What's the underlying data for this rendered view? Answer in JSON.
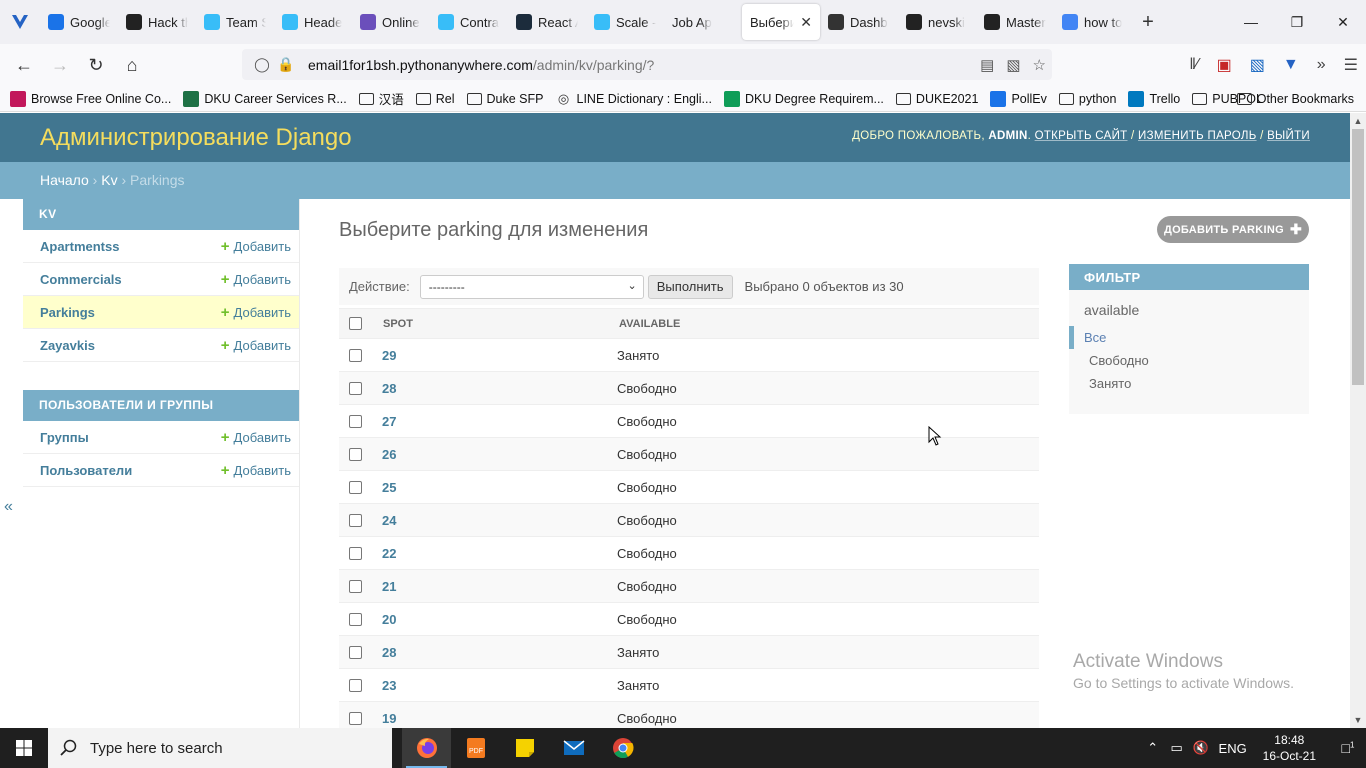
{
  "browser": {
    "tabs": [
      {
        "label": "Google",
        "icon": "calendar-icon",
        "color": "#1a73e8"
      },
      {
        "label": "Hack the",
        "icon": "d-logo-icon",
        "color": "#222222"
      },
      {
        "label": "Team S",
        "icon": "tailwind-icon",
        "color": "#38bdf8"
      },
      {
        "label": "Heade",
        "icon": "tailwind-icon",
        "color": "#38bdf8"
      },
      {
        "label": "Online",
        "icon": "s-logo-icon",
        "color": "#6b4fbb"
      },
      {
        "label": "Contra",
        "icon": "tailwind-icon",
        "color": "#38bdf8"
      },
      {
        "label": "React A",
        "icon": "react-icon",
        "color": "#1c2c3c"
      },
      {
        "label": "Scale -",
        "icon": "tailwind-icon",
        "color": "#38bdf8"
      },
      {
        "label": "Job Ap",
        "icon": "",
        "color": "#ffffff"
      },
      {
        "label": "Выбери",
        "icon": "",
        "color": "#ffffff",
        "active": true
      },
      {
        "label": "Dashb",
        "icon": "gauge-icon",
        "color": "#333333"
      },
      {
        "label": "nevski",
        "icon": "github-icon",
        "color": "#222222"
      },
      {
        "label": "Master",
        "icon": "github-icon",
        "color": "#222222"
      },
      {
        "label": "how to",
        "icon": "google-icon",
        "color": "#4285f4"
      }
    ],
    "url_host": "email1for1bsh.pythonanywhere.com",
    "url_path": "/admin/kv/parking/?",
    "bookmarks": [
      {
        "label": "Browse Free Online Co...",
        "icon": "site-icon",
        "color": "#c2185b"
      },
      {
        "label": "DKU Career Services R...",
        "icon": "excel-icon",
        "color": "#1e7145"
      },
      {
        "label": "汉语",
        "icon": "folder-icon"
      },
      {
        "label": "Rel",
        "icon": "folder-icon"
      },
      {
        "label": "Duke SFP",
        "icon": "folder-icon"
      },
      {
        "label": "LINE Dictionary : Engli...",
        "icon": "globe-icon"
      },
      {
        "label": "DKU Degree Requirem...",
        "icon": "sheets-icon",
        "color": "#0f9d58"
      },
      {
        "label": "DUKE2021",
        "icon": "folder-icon"
      },
      {
        "label": "PollEv",
        "icon": "pollev-icon",
        "color": "#1a73e8"
      },
      {
        "label": "python",
        "icon": "folder-icon"
      },
      {
        "label": "Trello",
        "icon": "trello-icon",
        "color": "#0079bf"
      },
      {
        "label": "PUBPOL",
        "icon": "folder-icon"
      }
    ],
    "other_bookmarks": "Other Bookmarks"
  },
  "admin": {
    "site_title": "Администрирование Django",
    "user_tools": {
      "welcome": "ДОБРО ПОЖАЛОВАТЬ,",
      "username": "ADMIN",
      "view_site": "ОТКРЫТЬ САЙТ",
      "change_password": "ИЗМЕНИТЬ ПАРОЛЬ",
      "logout": "ВЫЙТИ"
    },
    "breadcrumbs": {
      "home": "Начало",
      "app": "Kv",
      "current": "Parkings"
    },
    "sidebar": {
      "apps": [
        {
          "caption": "KV",
          "models": [
            {
              "name": "Apartmentss",
              "add": "Добавить"
            },
            {
              "name": "Commercials",
              "add": "Добавить"
            },
            {
              "name": "Parkings",
              "add": "Добавить",
              "current": true
            },
            {
              "name": "Zayavkis",
              "add": "Добавить"
            }
          ]
        },
        {
          "caption": "ПОЛЬЗОВАТЕЛИ И ГРУППЫ",
          "models": [
            {
              "name": "Группы",
              "add": "Добавить"
            },
            {
              "name": "Пользователи",
              "add": "Добавить"
            }
          ]
        }
      ],
      "collapse_glyph": "«"
    },
    "content": {
      "title": "Выберите parking для изменения",
      "add_button": "ДОБАВИТЬ PARKING",
      "actions": {
        "label": "Действие:",
        "select_value": "---------",
        "go": "Выполнить",
        "counter": "Выбрано 0 объектов из 30"
      },
      "columns": [
        "SPOT",
        "AVAILABLE"
      ],
      "rows": [
        {
          "spot": "29",
          "available": "Занято"
        },
        {
          "spot": "28",
          "available": "Свободно"
        },
        {
          "spot": "27",
          "available": "Свободно"
        },
        {
          "spot": "26",
          "available": "Свободно"
        },
        {
          "spot": "25",
          "available": "Свободно"
        },
        {
          "spot": "24",
          "available": "Свободно"
        },
        {
          "spot": "22",
          "available": "Свободно"
        },
        {
          "spot": "21",
          "available": "Свободно"
        },
        {
          "spot": "20",
          "available": "Свободно"
        },
        {
          "spot": "28",
          "available": "Занято"
        },
        {
          "spot": "23",
          "available": "Занято"
        },
        {
          "spot": "19",
          "available": "Свободно"
        }
      ]
    },
    "filter": {
      "title": "ФИЛЬТР",
      "field": "available",
      "options": [
        {
          "label": "Все",
          "selected": true
        },
        {
          "label": "Свободно"
        },
        {
          "label": "Занято"
        }
      ]
    },
    "colors": {
      "header_bg": "#417690",
      "branding": "#f5dd5d",
      "breadcrumb_bg": "#79aec8",
      "link": "#447e9b",
      "add_green": "#70bf2b",
      "current_row": "#ffffcc"
    }
  },
  "watermark": {
    "title": "Activate Windows",
    "subtitle": "Go to Settings to activate Windows."
  },
  "taskbar": {
    "search_placeholder": "Type here to search",
    "apps": [
      "firefox-icon",
      "pdf-icon",
      "sticky-notes-icon",
      "mail-icon",
      "chrome-icon"
    ],
    "language": "ENG",
    "time": "18:48",
    "date": "16-Oct-21",
    "notification_count": "1"
  }
}
